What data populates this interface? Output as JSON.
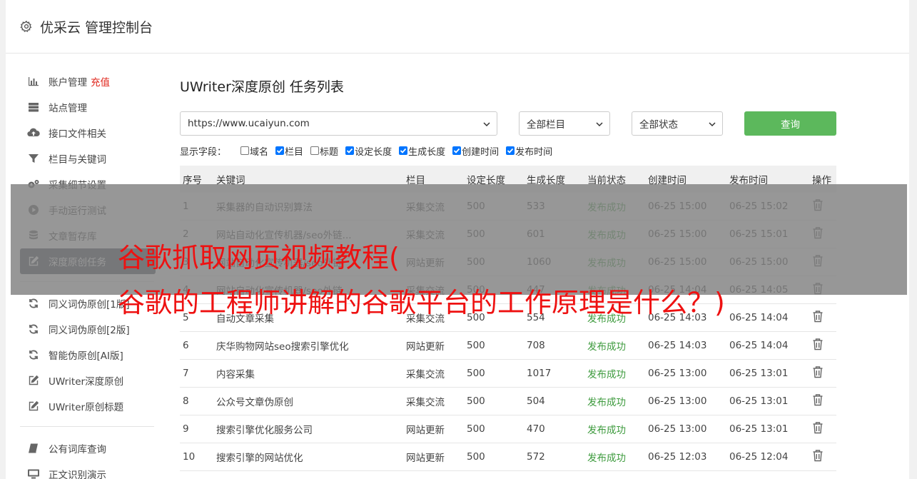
{
  "header": {
    "title": "优采云 管理控制台",
    "icon": "gear-icon"
  },
  "sidebar": {
    "group1": [
      {
        "label": "账户管理",
        "extra": "充值",
        "icon": "bar-chart-icon"
      },
      {
        "label": "站点管理",
        "icon": "server-icon"
      },
      {
        "label": "接口文件相关",
        "icon": "cloud-upload-icon"
      },
      {
        "label": "栏目与关键词",
        "icon": "filter-icon"
      },
      {
        "label": "采集细节设置",
        "icon": "cogs-icon"
      },
      {
        "label": "手动运行测试",
        "icon": "play-circle-icon"
      },
      {
        "label": "文章暂存库",
        "icon": "database-icon"
      },
      {
        "label": "深度原创任务",
        "icon": "edit-icon",
        "active": true
      }
    ],
    "group2": [
      {
        "label": "同义词伪原创[1版]",
        "icon": "refresh-icon"
      },
      {
        "label": "同义词伪原创[2版]",
        "icon": "refresh-icon"
      },
      {
        "label": "智能伪原创[AI版]",
        "icon": "refresh-icon"
      },
      {
        "label": "UWriter深度原创",
        "icon": "edit-icon"
      },
      {
        "label": "UWriter原创标题",
        "icon": "edit-icon"
      }
    ],
    "group3": [
      {
        "label": "公有词库查询",
        "icon": "book-icon"
      },
      {
        "label": "正文识别演示",
        "icon": "monitor-icon"
      }
    ]
  },
  "main": {
    "title": "UWriter深度原创 任务列表",
    "site_select": "https://www.ucaiyun.com",
    "column_select": "全部栏目",
    "status_select": "全部状态",
    "query_button": "查询",
    "fields_label": "显示字段：",
    "fields": [
      {
        "label": "域名",
        "checked": false
      },
      {
        "label": "栏目",
        "checked": true
      },
      {
        "label": "标题",
        "checked": false
      },
      {
        "label": "设定长度",
        "checked": true
      },
      {
        "label": "生成长度",
        "checked": true
      },
      {
        "label": "创建时间",
        "checked": true
      },
      {
        "label": "发布时间",
        "checked": true
      }
    ]
  },
  "table": {
    "headers": [
      "序号",
      "关键词",
      "栏目",
      "设定长度",
      "生成长度",
      "当前状态",
      "创建时间",
      "发布时间",
      "操作"
    ],
    "rows": [
      [
        "1",
        "采集器的自动识别算法",
        "采集交流",
        "500",
        "533",
        "发布成功",
        "06-25 15:00",
        "06-25 15:02"
      ],
      [
        "2",
        "网站自动化宣传机器/seo外链...",
        "采集交流",
        "500",
        "601",
        "发布成功",
        "06-25 15:00",
        "06-25 15:01"
      ],
      [
        "3",
        "网站自动化宣传机器/seo外链",
        "网站更新",
        "500",
        "1060",
        "发布成功",
        "06-25 15:00",
        "06-25 15:00"
      ],
      [
        "4",
        "网站自动化宣传机器/seo外链",
        "采集交流",
        "500",
        "447",
        "发布成功",
        "06-25 14:04",
        "06-25 14:05"
      ],
      [
        "5",
        "自动文章采集",
        "采集交流",
        "500",
        "554",
        "发布成功",
        "06-25 14:03",
        "06-25 14:04"
      ],
      [
        "6",
        "庆华购物网站seo搜索引擎优化",
        "网站更新",
        "500",
        "708",
        "发布成功",
        "06-25 14:03",
        "06-25 14:04"
      ],
      [
        "7",
        "内容采集",
        "采集交流",
        "500",
        "1017",
        "发布成功",
        "06-25 13:00",
        "06-25 13:01"
      ],
      [
        "8",
        "公众号文章伪原创",
        "采集交流",
        "500",
        "504",
        "发布成功",
        "06-25 13:00",
        "06-25 13:01"
      ],
      [
        "9",
        "搜索引擎优化服务公司",
        "网站更新",
        "500",
        "470",
        "发布成功",
        "06-25 13:00",
        "06-25 13:01"
      ],
      [
        "10",
        "搜索引擎的网站优化",
        "网站更新",
        "500",
        "572",
        "发布成功",
        "06-25 12:03",
        "06-25 12:04"
      ]
    ]
  },
  "watermark": {
    "line1": "谷歌抓取网页视频教程(",
    "line2": "谷歌的工程师讲解的谷歌平台的工作原理是什么？)"
  },
  "colors": {
    "accent": "#5cb85c",
    "active_sidebar": "#4b5058",
    "success": "#3c9a3c",
    "watermark": "#ee1111",
    "recharge": "#e0241a"
  }
}
